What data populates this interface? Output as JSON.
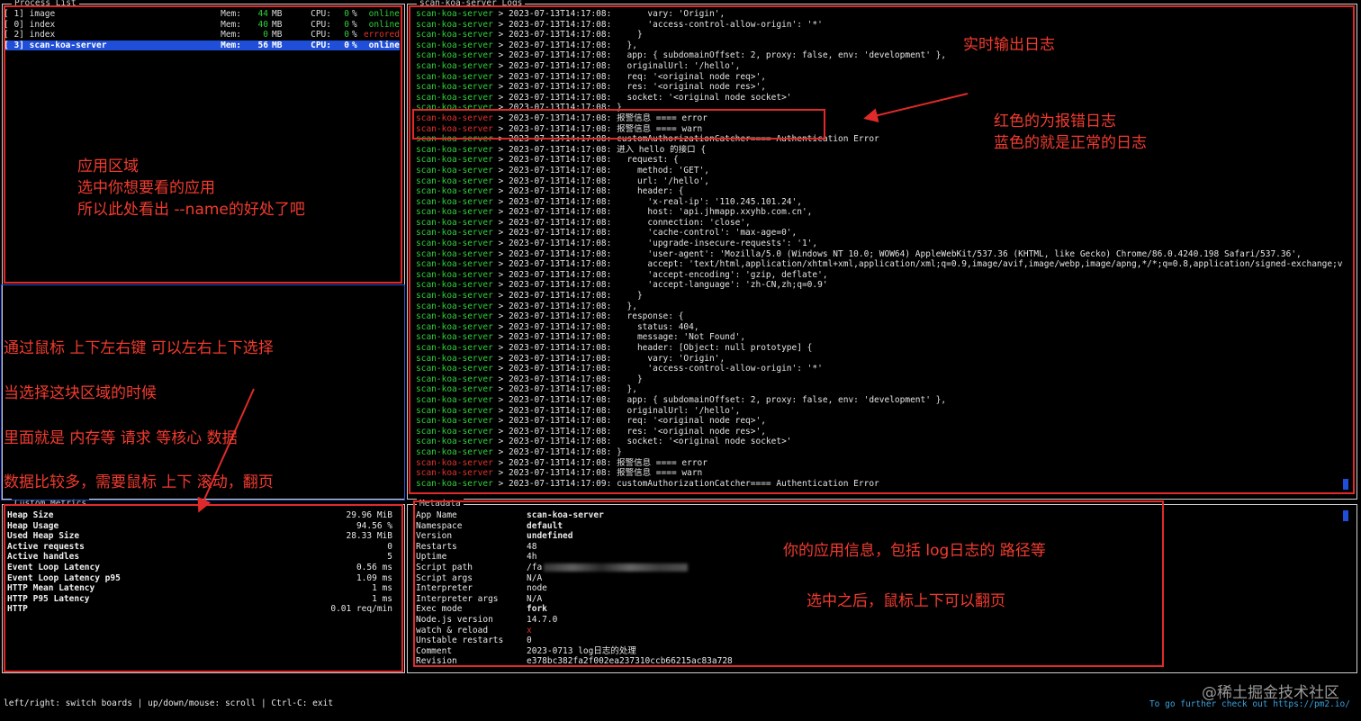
{
  "panels": {
    "process_list_title": "Process List",
    "logs_title": "scan-koa-server Logs",
    "metrics_title": "Custom Metrics",
    "metadata_title": "Metadata"
  },
  "process_list": [
    {
      "id": "[ 1]",
      "name": "image",
      "mem_label": "Mem:",
      "mem": "44",
      "unit": "MB",
      "cpu_label": "CPU:",
      "cpu": "0",
      "pct": "%",
      "status": "online",
      "mem_color": "#2fcf3a",
      "status_color": "#2fcf3a",
      "selected": false
    },
    {
      "id": "[ 0]",
      "name": "index",
      "mem_label": "Mem:",
      "mem": "40",
      "unit": "MB",
      "cpu_label": "CPU:",
      "cpu": "0",
      "pct": "%",
      "status": "online",
      "mem_color": "#2fcf3a",
      "status_color": "#2fcf3a",
      "selected": false
    },
    {
      "id": "[ 2]",
      "name": "index",
      "mem_label": "Mem:",
      "mem": "0",
      "unit": "MB",
      "cpu_label": "CPU:",
      "cpu": "0",
      "pct": "%",
      "status": "errored",
      "mem_color": "#2fcf3a",
      "status_color": "#e0312d",
      "selected": false
    },
    {
      "id": "[ 3]",
      "name": "scan-koa-server",
      "mem_label": "Mem:",
      "mem": "56",
      "unit": "MB",
      "cpu_label": "CPU:",
      "cpu": "0",
      "pct": "%",
      "status": "online",
      "mem_color": "#ffffff",
      "status_color": "#ffffff",
      "selected": true
    }
  ],
  "logs": [
    {
      "name": "scan-koa-server",
      "color": "green",
      "text": " > 2023-07-13T14:17:08:       vary: 'Origin',"
    },
    {
      "name": "scan-koa-server",
      "color": "green",
      "text": " > 2023-07-13T14:17:08:       'access-control-allow-origin': '*'"
    },
    {
      "name": "scan-koa-server",
      "color": "green",
      "text": " > 2023-07-13T14:17:08:     }"
    },
    {
      "name": "scan-koa-server",
      "color": "green",
      "text": " > 2023-07-13T14:17:08:   },"
    },
    {
      "name": "scan-koa-server",
      "color": "green",
      "text": " > 2023-07-13T14:17:08:   app: { subdomainOffset: 2, proxy: false, env: 'development' },"
    },
    {
      "name": "scan-koa-server",
      "color": "green",
      "text": " > 2023-07-13T14:17:08:   originalUrl: '/hello',"
    },
    {
      "name": "scan-koa-server",
      "color": "green",
      "text": " > 2023-07-13T14:17:08:   req: '<original node req>',"
    },
    {
      "name": "scan-koa-server",
      "color": "green",
      "text": " > 2023-07-13T14:17:08:   res: '<original node res>',"
    },
    {
      "name": "scan-koa-server",
      "color": "green",
      "text": " > 2023-07-13T14:17:08:   socket: '<original node socket>'"
    },
    {
      "name": "scan-koa-server",
      "color": "green",
      "text": " > 2023-07-13T14:17:08: }"
    },
    {
      "name": "scan-koa-server",
      "color": "red",
      "text": " > 2023-07-13T14:17:08: 报警信息 ==== error"
    },
    {
      "name": "scan-koa-server",
      "color": "red",
      "text": " > 2023-07-13T14:17:08: 报警信息 ==== warn"
    },
    {
      "name": "scan-koa-server",
      "color": "green",
      "text": " > 2023-07-13T14:17:08: customAuthorizationCatcher==== Authentication Error"
    },
    {
      "name": "scan-koa-server",
      "color": "green",
      "text": " > 2023-07-13T14:17:08: 进入 hello 的接口 {"
    },
    {
      "name": "scan-koa-server",
      "color": "green",
      "text": " > 2023-07-13T14:17:08:   request: {"
    },
    {
      "name": "scan-koa-server",
      "color": "green",
      "text": " > 2023-07-13T14:17:08:     method: 'GET',"
    },
    {
      "name": "scan-koa-server",
      "color": "green",
      "text": " > 2023-07-13T14:17:08:     url: '/hello',"
    },
    {
      "name": "scan-koa-server",
      "color": "green",
      "text": " > 2023-07-13T14:17:08:     header: {"
    },
    {
      "name": "scan-koa-server",
      "color": "green",
      "text": " > 2023-07-13T14:17:08:       'x-real-ip': '110.245.101.24',"
    },
    {
      "name": "scan-koa-server",
      "color": "green",
      "text": " > 2023-07-13T14:17:08:       host: 'api.jhmapp.xxyhb.com.cn',"
    },
    {
      "name": "scan-koa-server",
      "color": "green",
      "text": " > 2023-07-13T14:17:08:       connection: 'close',"
    },
    {
      "name": "scan-koa-server",
      "color": "green",
      "text": " > 2023-07-13T14:17:08:       'cache-control': 'max-age=0',"
    },
    {
      "name": "scan-koa-server",
      "color": "green",
      "text": " > 2023-07-13T14:17:08:       'upgrade-insecure-requests': '1',"
    },
    {
      "name": "scan-koa-server",
      "color": "green",
      "text": " > 2023-07-13T14:17:08:       'user-agent': 'Mozilla/5.0 (Windows NT 10.0; WOW64) AppleWebKit/537.36 (KHTML, like Gecko) Chrome/86.0.4240.198 Safari/537.36',"
    },
    {
      "name": "scan-koa-server",
      "color": "green",
      "text": " > 2023-07-13T14:17:08:       accept: 'text/html,application/xhtml+xml,application/xml;q=0.9,image/avif,image/webp,image/apng,*/*;q=0.8,application/signed-exchange;v=b3;"
    },
    {
      "name": "scan-koa-server",
      "color": "green",
      "text": " > 2023-07-13T14:17:08:       'accept-encoding': 'gzip, deflate',"
    },
    {
      "name": "scan-koa-server",
      "color": "green",
      "text": " > 2023-07-13T14:17:08:       'accept-language': 'zh-CN,zh;q=0.9'"
    },
    {
      "name": "scan-koa-server",
      "color": "green",
      "text": " > 2023-07-13T14:17:08:     }"
    },
    {
      "name": "scan-koa-server",
      "color": "green",
      "text": " > 2023-07-13T14:17:08:   },"
    },
    {
      "name": "scan-koa-server",
      "color": "green",
      "text": " > 2023-07-13T14:17:08:   response: {"
    },
    {
      "name": "scan-koa-server",
      "color": "green",
      "text": " > 2023-07-13T14:17:08:     status: 404,"
    },
    {
      "name": "scan-koa-server",
      "color": "green",
      "text": " > 2023-07-13T14:17:08:     message: 'Not Found',"
    },
    {
      "name": "scan-koa-server",
      "color": "green",
      "text": " > 2023-07-13T14:17:08:     header: [Object: null prototype] {"
    },
    {
      "name": "scan-koa-server",
      "color": "green",
      "text": " > 2023-07-13T14:17:08:       vary: 'Origin',"
    },
    {
      "name": "scan-koa-server",
      "color": "green",
      "text": " > 2023-07-13T14:17:08:       'access-control-allow-origin': '*'"
    },
    {
      "name": "scan-koa-server",
      "color": "green",
      "text": " > 2023-07-13T14:17:08:     }"
    },
    {
      "name": "scan-koa-server",
      "color": "green",
      "text": " > 2023-07-13T14:17:08:   },"
    },
    {
      "name": "scan-koa-server",
      "color": "green",
      "text": " > 2023-07-13T14:17:08:   app: { subdomainOffset: 2, proxy: false, env: 'development' },"
    },
    {
      "name": "scan-koa-server",
      "color": "green",
      "text": " > 2023-07-13T14:17:08:   originalUrl: '/hello',"
    },
    {
      "name": "scan-koa-server",
      "color": "green",
      "text": " > 2023-07-13T14:17:08:   req: '<original node req>',"
    },
    {
      "name": "scan-koa-server",
      "color": "green",
      "text": " > 2023-07-13T14:17:08:   res: '<original node res>',"
    },
    {
      "name": "scan-koa-server",
      "color": "green",
      "text": " > 2023-07-13T14:17:08:   socket: '<original node socket>'"
    },
    {
      "name": "scan-koa-server",
      "color": "green",
      "text": " > 2023-07-13T14:17:08: }"
    },
    {
      "name": "scan-koa-server",
      "color": "red",
      "text": " > 2023-07-13T14:17:08: 报警信息 ==== error"
    },
    {
      "name": "scan-koa-server",
      "color": "red",
      "text": " > 2023-07-13T14:17:08: 报警信息 ==== warn"
    },
    {
      "name": "scan-koa-server",
      "color": "green",
      "text": " > 2023-07-13T14:17:09: customAuthorizationCatcher==== Authentication Error"
    }
  ],
  "metrics": [
    {
      "label": "Heap Size",
      "value": "29.96 MiB"
    },
    {
      "label": "Heap Usage",
      "value": "94.56 %"
    },
    {
      "label": "Used Heap Size",
      "value": "28.33 MiB"
    },
    {
      "label": "Active requests",
      "value": "0"
    },
    {
      "label": "Active handles",
      "value": "5"
    },
    {
      "label": "Event Loop Latency",
      "value": "0.56 ms"
    },
    {
      "label": "Event Loop Latency p95",
      "value": "1.09 ms"
    },
    {
      "label": "HTTP Mean Latency",
      "value": "1 ms"
    },
    {
      "label": "HTTP P95 Latency",
      "value": "1 ms"
    },
    {
      "label": "HTTP",
      "value": "0.01 req/min"
    }
  ],
  "metadata": [
    {
      "key": "App Name",
      "value": "scan-koa-server",
      "style": "bold"
    },
    {
      "key": "Namespace",
      "value": "default",
      "style": "bold"
    },
    {
      "key": "Version",
      "value": "undefined",
      "style": "bold"
    },
    {
      "key": "Restarts",
      "value": "48",
      "style": ""
    },
    {
      "key": "Uptime",
      "value": "4h",
      "style": ""
    },
    {
      "key": "Script path",
      "value": "/fa",
      "style": "blur"
    },
    {
      "key": "Script args",
      "value": "N/A",
      "style": ""
    },
    {
      "key": "Interpreter",
      "value": "node",
      "style": ""
    },
    {
      "key": "Interpreter args",
      "value": "N/A",
      "style": ""
    },
    {
      "key": "Exec mode",
      "value": "fork",
      "style": "bold"
    },
    {
      "key": "Node.js version",
      "value": "14.7.0",
      "style": ""
    },
    {
      "key": "watch & reload",
      "value": "x",
      "style": "redx"
    },
    {
      "key": "Unstable restarts",
      "value": "0",
      "style": ""
    },
    {
      "key": "Comment",
      "value": "2023-0713 log日志的处理",
      "style": ""
    },
    {
      "key": "Revision",
      "value": "e378bc382fa2f002ea237310ccb66215ac83a728",
      "style": ""
    }
  ],
  "annotations": {
    "app_area": [
      "应用区域",
      "选中你想要看的应用",
      "所以此处看出 --name的好处了吧"
    ],
    "realtime": "实时输出日志",
    "colors": [
      "红色的为报错日志",
      "蓝色的就是正常的日志"
    ],
    "left_notes": [
      "通过鼠标 上下左右键 可以左右上下选择",
      "当选择这块区域的时候",
      "里面就是 内存等 请求 等核心 数据",
      "数据比较多，需要鼠标 上下 滚动，翻页"
    ],
    "meta_notes": [
      "你的应用信息，包括 log日志的 路径等",
      "选中之后，鼠标上下可以翻页"
    ]
  },
  "footer": {
    "help": "left/right: switch boards | up/down/mouse: scroll | Ctrl-C: exit",
    "link": "To go further check out https://pm2.io/",
    "watermark": "@稀土掘金技术社区"
  },
  "colors": {
    "green": "#2fcf3a",
    "red": "#e0312d",
    "select_blue": "#1f4fd8",
    "annotation_red": "#f23b2f"
  }
}
